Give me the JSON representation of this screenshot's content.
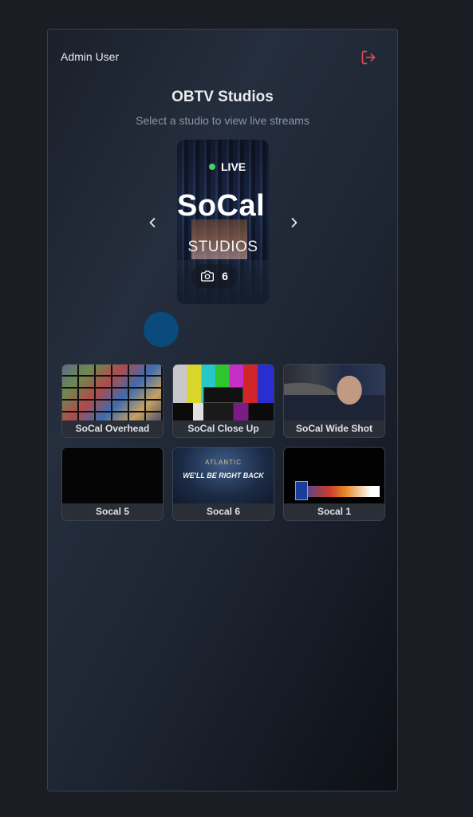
{
  "header": {
    "user": "Admin User",
    "logout_icon": "logout-icon",
    "accent_color": "#e5484d"
  },
  "main": {
    "title": "OBTV Studios",
    "subtitle": "Select a studio to view live streams"
  },
  "carousel": {
    "prev_icon": "chevron-left-icon",
    "next_icon": "chevron-right-icon",
    "studio": {
      "status": "LIVE",
      "status_color": "#41d16b",
      "name": "SoCal",
      "subtitle": "STUDIOS",
      "camera_count": "6",
      "camera_icon": "camera-icon"
    }
  },
  "streams": [
    {
      "label": "SoCal Overhead"
    },
    {
      "label": "SoCal Close Up"
    },
    {
      "label": "SoCal Wide Shot"
    },
    {
      "label": "Socal 5"
    },
    {
      "label": "Socal 6",
      "thumb_logo": "ATLANTIC",
      "thumb_text": "WE'LL BE RIGHT BACK"
    },
    {
      "label": "Socal 1"
    }
  ]
}
